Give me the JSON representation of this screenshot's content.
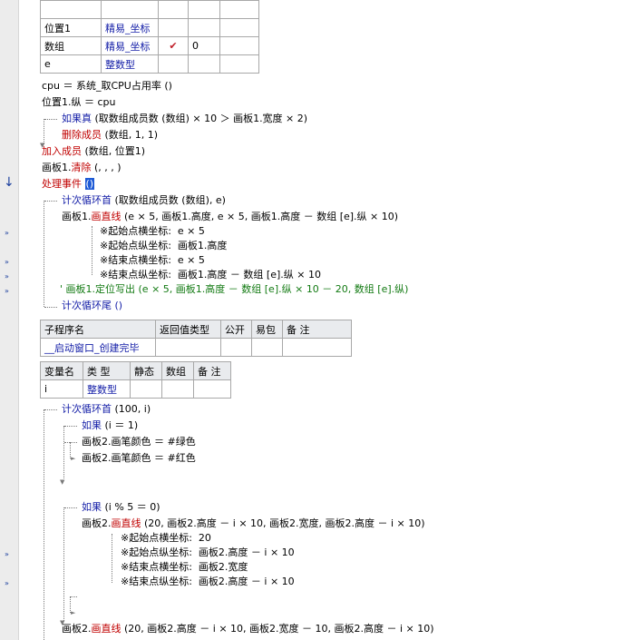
{
  "gutter_marks": [
    "»",
    "»",
    "»",
    "»",
    "»",
    "»",
    "»",
    "»"
  ],
  "event_marker": "↓",
  "vartable_top": [
    {
      "name": "",
      "type": "",
      "static": "",
      "array": "",
      "note": ""
    },
    {
      "name": "位置1",
      "type": "精易_坐标",
      "static": "",
      "array": "",
      "note": ""
    },
    {
      "name": "数组",
      "type": "精易_坐标",
      "static": "✔",
      "array": "0",
      "note": ""
    },
    {
      "name": "e",
      "type": "整数型",
      "static": "",
      "array": "",
      "note": ""
    }
  ],
  "lines": {
    "cpu": "cpu ＝ 系统_取CPU占用率 ()",
    "pos": "位置1.纵 ＝ cpu",
    "if_kw": "如果真",
    "if_cond": " (取数组成员数 (数组) × 10 ＞ 画板1.宽度 × 2)",
    "del_kw": "删除成员",
    "del_args": " (数组, 1, 1)",
    "add_kw": "加入成员",
    "add_args": " (数组, 位置1)",
    "clear_obj": "画板1.",
    "clear_kw": "清除",
    "clear_args": " (, , , )",
    "ev_kw": "处理事件",
    "ev_args": "()",
    "loop_kw": "计次循环首",
    "loop_args": " (取数组成员数 (数组), e)",
    "draw_obj": "画板1.",
    "draw_kw": "画直线",
    "draw_args": " (e × 5, 画板1.高度, e × 5, 画板1.高度 － 数组 [e].纵 × 10)",
    "p1": "※起始点横坐标:  e × 5",
    "p2": "※起始点纵坐标:  画板1.高度",
    "p3": "※结束点横坐标:  e × 5",
    "p4": "※结束点纵坐标:  画板1.高度 － 数组 [e].纵 × 10",
    "comment": "' 画板1.定位写出 (e × 5, 画板1.高度 － 数组 [e].纵 × 10 － 20, 数组 [e].纵)",
    "loop_end": "计次循环尾 ()",
    "loop2_kw": "计次循环首",
    "loop2_args": " (100, i)",
    "if2_kw": "如果",
    "if2_args": " (i ＝ 1)",
    "pen_green": "画板2.画笔颜色 ＝ #绿色",
    "pen_red": "画板2.画笔颜色 ＝ #红色",
    "if3_kw": "如果",
    "if3_args": " (i % 5 ＝ 0)",
    "draw2_obj": "画板2.",
    "draw2_kw": "画直线",
    "draw2_args": " (20, 画板2.高度 － i × 10, 画板2.宽度, 画板2.高度 － i × 10)",
    "q1": "※起始点横坐标:  20",
    "q2": "※起始点纵坐标:  画板2.高度 － i × 10",
    "q3": "※结束点横坐标:  画板2.宽度",
    "q4": "※结束点纵坐标:  画板2.高度 － i × 10",
    "draw3_obj": "画板2.",
    "draw3_kw": "画直线",
    "draw3_args": " (20, 画板2.高度 － i × 10, 画板2.宽度 － 10, 画板2.高度 － i × 10)"
  },
  "subtable": {
    "headers": [
      "子程序名",
      "返回值类型",
      "公开",
      "易包",
      "备 注"
    ],
    "row": [
      "__启动窗口_创建完毕",
      "",
      "",
      "",
      ""
    ]
  },
  "localtable": {
    "headers": [
      "变量名",
      "类 型",
      "静态",
      "数组",
      "备 注"
    ],
    "row": [
      "i",
      "整数型",
      "",
      "",
      ""
    ]
  }
}
